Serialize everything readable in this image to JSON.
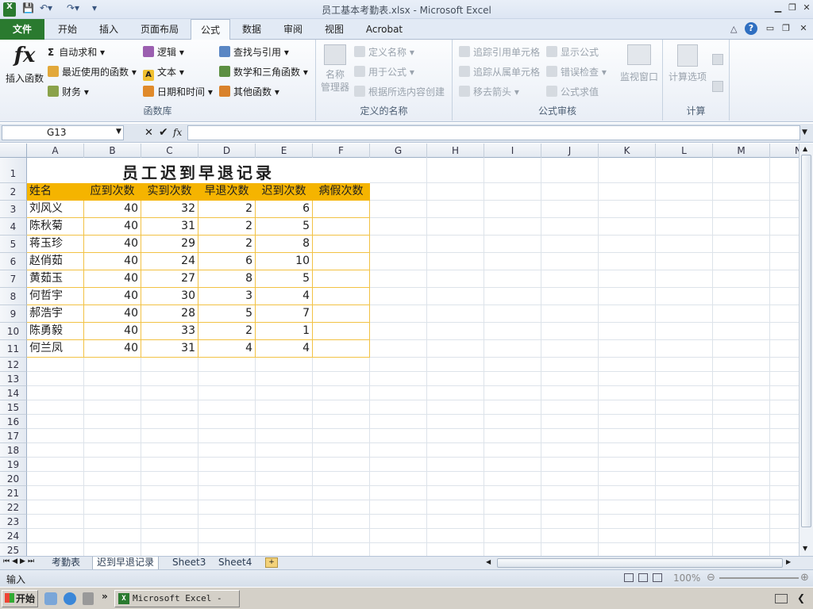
{
  "window": {
    "title": "员工基本考勤表.xlsx - Microsoft Excel"
  },
  "tabs": [
    "文件",
    "开始",
    "插入",
    "页面布局",
    "公式",
    "数据",
    "审阅",
    "视图",
    "Acrobat"
  ],
  "ribbon": {
    "insert_function": "插入函数",
    "function_library": {
      "label": "函数库",
      "items": [
        "自动求和",
        "最近使用的函数",
        "财务",
        "逻辑",
        "文本",
        "日期和时间",
        "查找与引用",
        "数学和三角函数",
        "其他函数"
      ]
    },
    "defined_names": {
      "label": "定义的名称",
      "name_manager": "名称\n管理器",
      "items": [
        "定义名称",
        "用于公式",
        "根据所选内容创建"
      ]
    },
    "formula_auditing": {
      "label": "公式审核",
      "items": [
        "追踪引用单元格",
        "追踪从属单元格",
        "移去箭头",
        "显示公式",
        "错误检查",
        "公式求值"
      ],
      "watch_window": "监视窗口"
    },
    "calculation": {
      "label": "计算",
      "options": "计算选项"
    }
  },
  "formula_bar": {
    "name_box": "G13",
    "fx": "fx",
    "value": ""
  },
  "columns": [
    "A",
    "B",
    "C",
    "D",
    "E",
    "F",
    "G",
    "H",
    "I",
    "J",
    "K",
    "L",
    "M",
    "N"
  ],
  "rows": [
    "1",
    "2",
    "3",
    "4",
    "5",
    "6",
    "7",
    "8",
    "9",
    "10",
    "11",
    "12",
    "13",
    "14",
    "15",
    "16",
    "17",
    "18",
    "19",
    "20",
    "21",
    "22",
    "23",
    "24",
    "25"
  ],
  "sheet": {
    "title": "员工迟到早退记录",
    "headers": [
      "姓名",
      "应到次数",
      "实到次数",
      "早退次数",
      "迟到次数",
      "病假次数"
    ],
    "data": [
      [
        "刘风义",
        "40",
        "32",
        "2",
        "6",
        ""
      ],
      [
        "陈秋菊",
        "40",
        "31",
        "2",
        "5",
        ""
      ],
      [
        "蒋玉珍",
        "40",
        "29",
        "2",
        "8",
        ""
      ],
      [
        "赵俏茹",
        "40",
        "24",
        "6",
        "10",
        ""
      ],
      [
        "黄茹玉",
        "40",
        "27",
        "8",
        "5",
        ""
      ],
      [
        "何哲宇",
        "40",
        "30",
        "3",
        "4",
        ""
      ],
      [
        "郝浩宇",
        "40",
        "28",
        "5",
        "7",
        ""
      ],
      [
        "陈勇毅",
        "40",
        "33",
        "2",
        "1",
        ""
      ],
      [
        "何兰凤",
        "40",
        "31",
        "4",
        "4",
        ""
      ]
    ]
  },
  "sheet_tabs": [
    "考勤表",
    "迟到早退记录",
    "Sheet3",
    "Sheet4"
  ],
  "status": {
    "mode": "输入",
    "zoom": "100%"
  },
  "taskbar": {
    "start": "开始",
    "app": "Microsoft Excel - ..."
  },
  "colors": {
    "header_fill": "#f5b400",
    "file_tab": "#2a7a2f"
  }
}
